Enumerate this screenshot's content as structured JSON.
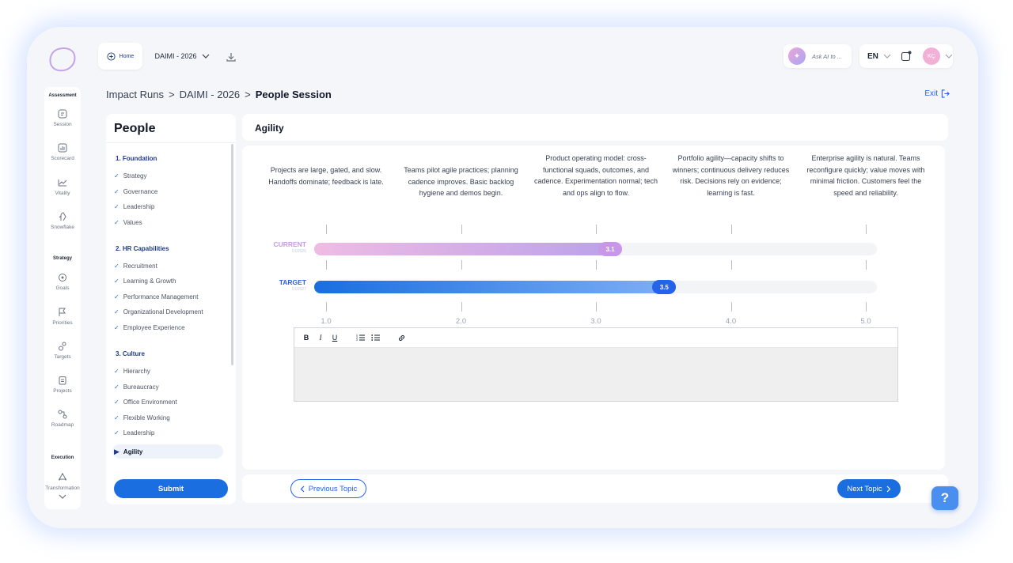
{
  "topbar": {
    "home_label": "Home",
    "project_value": "DAIMI - 2026",
    "ask_ai_placeholder": "Ask AI to ...",
    "language": "EN",
    "avatar_initials": "KÇ"
  },
  "sidebar": {
    "sections": [
      {
        "title": "Assessment",
        "items": [
          {
            "label": "Session",
            "icon": "session-icon"
          },
          {
            "label": "Scorecard",
            "icon": "scorecard-icon"
          },
          {
            "label": "Vitality",
            "icon": "vitality-icon"
          },
          {
            "label": "Snowflake",
            "icon": "snowflake-icon"
          }
        ]
      },
      {
        "title": "Strategy",
        "items": [
          {
            "label": "Goals",
            "icon": "goals-icon"
          },
          {
            "label": "Priorities",
            "icon": "flag-icon"
          },
          {
            "label": "Targets",
            "icon": "targets-icon"
          },
          {
            "label": "Projects",
            "icon": "projects-icon"
          },
          {
            "label": "Roadmap",
            "icon": "roadmap-icon"
          }
        ]
      },
      {
        "title": "Execution",
        "items": [
          {
            "label": "Transformation",
            "icon": "transformation-icon"
          }
        ]
      }
    ]
  },
  "breadcrumb": {
    "items": [
      "Impact Runs",
      "DAIMI - 2026"
    ],
    "separator": ">",
    "current": "People Session"
  },
  "exit_label": "Exit",
  "panel": {
    "title": "People",
    "groups": [
      {
        "title": "1. Foundation",
        "topics": [
          "Strategy",
          "Governance",
          "Leadership",
          "Values"
        ]
      },
      {
        "title": "2. HR Capabilities",
        "topics": [
          "Recruitment",
          "Learning & Growth",
          "Performance Management",
          "Organizational Development",
          "Employee Experience"
        ]
      },
      {
        "title": "3. Culture",
        "topics": [
          "Hierarchy",
          "Bureaucracy",
          "Office Environment",
          "Flexible Working",
          "Leadership",
          "Agility"
        ]
      }
    ],
    "active_topic": "Agility",
    "submit_label": "Submit"
  },
  "main": {
    "topic_title": "Agility",
    "level_descriptions": [
      "Projects are large, gated, and slow. Handoffs dominate; feedback is late.",
      "Teams pilot agile practices; planning cadence improves. Basic backlog hygiene and demos begin.",
      "Product operating model: cross-functional squads, outcomes, and cadence. Experimentation normal; tech and ops align to flow.",
      "Portfolio agility—capacity shifts to winners; continuous delivery reduces risk. Decisions rely on evidence; learning is fast.",
      "Enterprise agility is natural. Teams reconfigure quickly; value moves with minimal friction. Customers feel the speed and reliability."
    ],
    "scale": {
      "min": 1.0,
      "max": 5.0,
      "ticks": [
        "1.0",
        "2.0",
        "3.0",
        "4.0",
        "5.0"
      ]
    },
    "current": {
      "label": "CURRENT",
      "date": "01/2026",
      "value": 3.1,
      "value_label": "3.1",
      "color": "#c897ea"
    },
    "target": {
      "label": "TARGET",
      "date": "01/2027",
      "value": 3.5,
      "value_label": "3.5",
      "color": "#2563eb"
    },
    "editor": {
      "tools": [
        "B",
        "I",
        "U",
        "ordered-list-icon",
        "bullet-list-icon",
        "link-icon"
      ],
      "value": ""
    },
    "prev_label": "Previous Topic",
    "next_label": "Next Topic"
  },
  "help_label": "?"
}
